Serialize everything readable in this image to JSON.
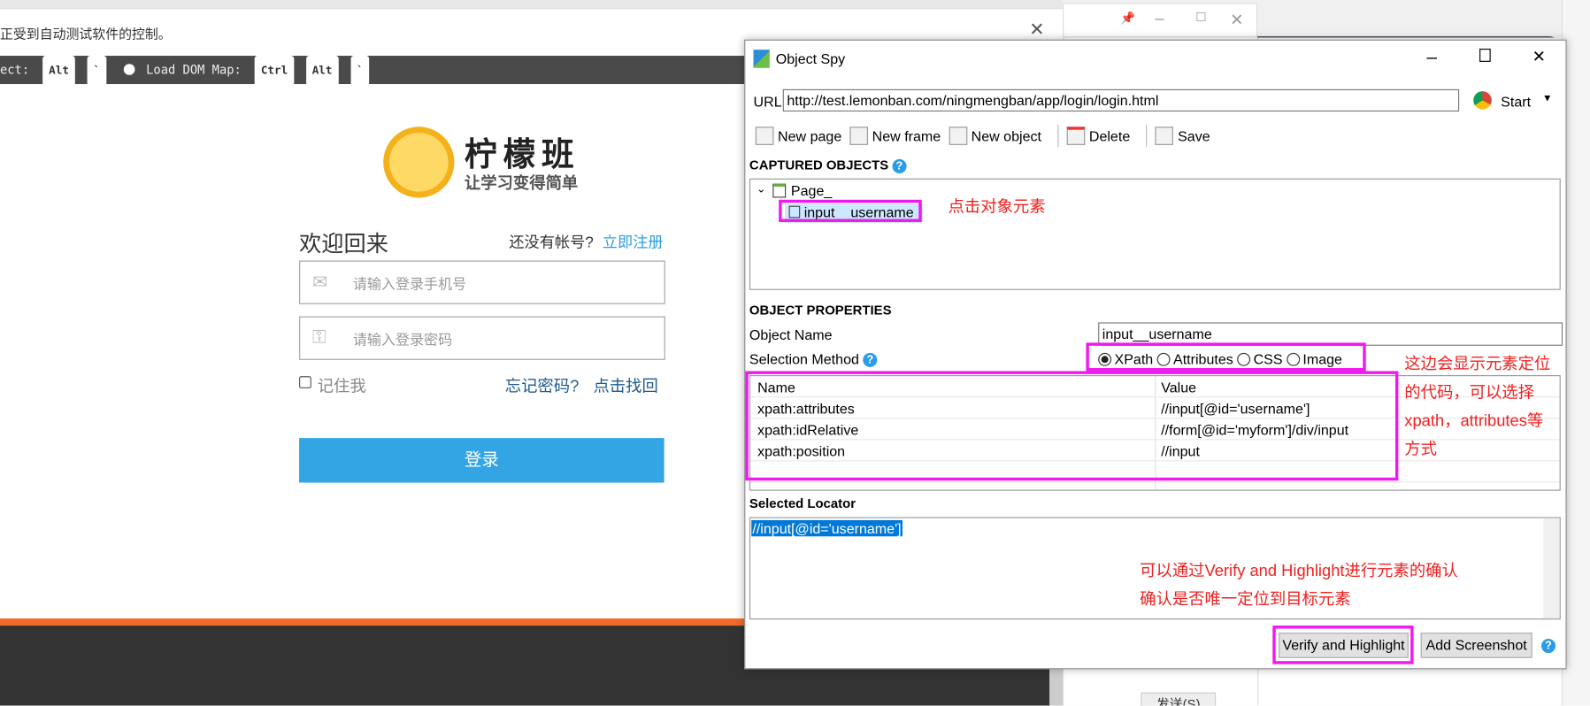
{
  "browser": {
    "infobar_text": "正受到自动测试软件的控制。",
    "spy_bar": {
      "select_label": "ect:",
      "select_keys": [
        "Alt",
        "`"
      ],
      "dom_map_label": "Load DOM Map:",
      "dom_map_keys": [
        "Ctrl",
        "Alt",
        "`"
      ]
    },
    "page": {
      "logo_title": "柠檬班",
      "logo_slogan": "让学习变得简单",
      "welcome": "欢迎回来",
      "no_account": "还没有帐号?",
      "register_link": "立即注册",
      "phone_placeholder": "请输入登录手机号",
      "password_placeholder": "请输入登录密码",
      "remember_me": "记住我",
      "forgot_password": "忘记密码?",
      "recover_link": "点击找回",
      "login_button": "登录"
    }
  },
  "background_window": {
    "send_button": "发送(S)"
  },
  "object_spy": {
    "title": "Object Spy",
    "url_label": "URL",
    "url_value": "http://test.lemonban.com/ningmengban/app/login/login.html",
    "start_label": "Start",
    "toolbar": [
      "New page",
      "New frame",
      "New object",
      "Delete",
      "Save"
    ],
    "captured_objects_title": "CAPTURED OBJECTS",
    "tree": {
      "page": "Page_",
      "child": "input__username"
    },
    "object_properties_title": "OBJECT PROPERTIES",
    "object_name_label": "Object Name",
    "object_name_value": "input__username",
    "selection_method_label": "Selection Method",
    "selection_methods": [
      "XPath",
      "Attributes",
      "CSS",
      "Image"
    ],
    "selected_method": "XPath",
    "table": {
      "headers": [
        "Name",
        "Value"
      ],
      "rows": [
        [
          "xpath:attributes",
          "//input[@id='username']"
        ],
        [
          "xpath:idRelative",
          "//form[@id='myform']/div/input"
        ],
        [
          "xpath:position",
          "//input"
        ]
      ]
    },
    "selected_locator_title": "Selected Locator",
    "selected_locator_value": "//input[@id='username']",
    "verify_button": "Verify and Highlight",
    "add_screenshot_button": "Add Screenshot"
  },
  "annotations": {
    "click_object": "点击对象元素",
    "locator_note": [
      "这边会显示元素定位",
      "的代码，可以选择",
      "xpath，attributes等",
      "方式"
    ],
    "verify_note": [
      "可以通过Verify and Highlight进行元素的确认",
      "确认是否唯一定位到目标元素"
    ]
  }
}
